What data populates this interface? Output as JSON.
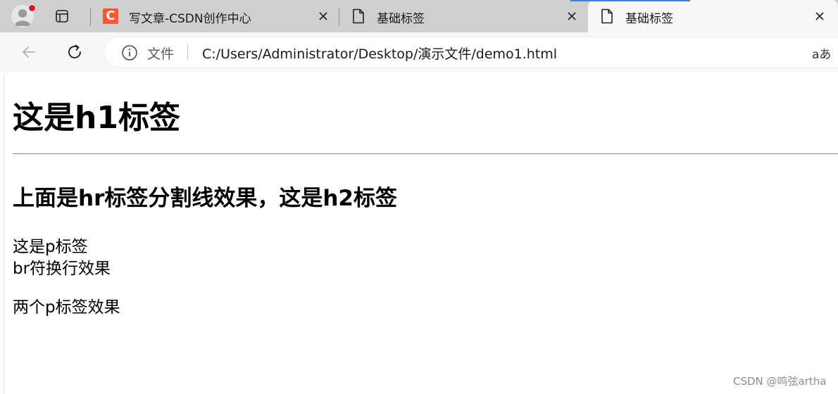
{
  "tabs": [
    {
      "title": "写文章-CSDN创作中心",
      "icon": "csdn-logo-icon",
      "favicon_letter": "C",
      "active": false
    },
    {
      "title": "基础标签",
      "icon": "file-icon",
      "active": false
    },
    {
      "title": "基础标签",
      "icon": "file-icon",
      "active": true
    }
  ],
  "toolbar": {
    "site_info_label": "文件",
    "url": "C:/Users/Administrator/Desktop/演示文件/demo1.html",
    "read_aloud_label": "aあ"
  },
  "page": {
    "h1": "这是h1标签",
    "h2": "上面是hr标签分割线效果，这是h2标签",
    "p1_line1": "这是p标签",
    "p1_line2": "br符换行效果",
    "p2": "两个p标签效果"
  },
  "watermark": "CSDN @鸣弦artha",
  "colors": {
    "tabstrip_bg": "#cfcfcf",
    "active_tab_bg": "#f7f7f7",
    "csdn_brand": "#fc5531",
    "profile_dot": "#e81123"
  }
}
